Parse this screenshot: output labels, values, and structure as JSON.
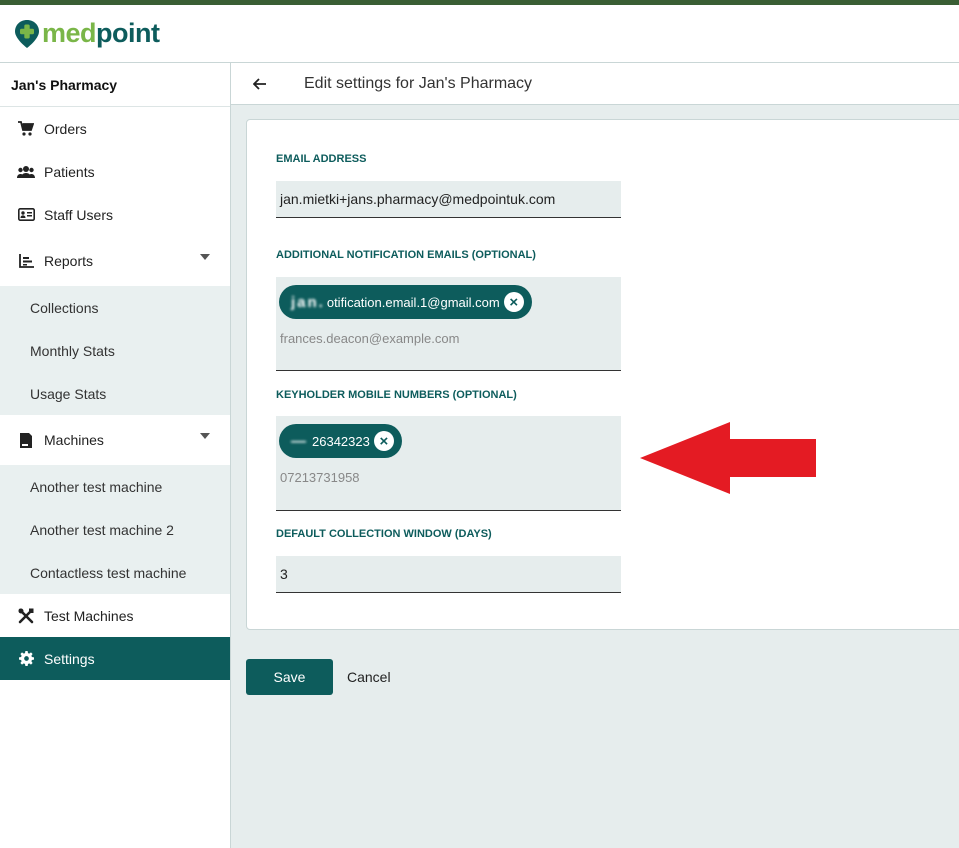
{
  "brand": {
    "name_part1": "med",
    "name_part2": "point"
  },
  "sidebar": {
    "pharmacy": "Jan's Pharmacy",
    "items": [
      {
        "label": "Orders",
        "icon": "cart-icon"
      },
      {
        "label": "Patients",
        "icon": "users-icon"
      },
      {
        "label": "Staff Users",
        "icon": "id-card-icon"
      },
      {
        "label": "Reports",
        "icon": "bar-chart-icon"
      },
      {
        "label": "Collections"
      },
      {
        "label": "Monthly Stats"
      },
      {
        "label": "Usage Stats"
      },
      {
        "label": "Machines",
        "icon": "machine-icon"
      },
      {
        "label": "Another test machine"
      },
      {
        "label": "Another test machine 2"
      },
      {
        "label": "Contactless test machine"
      },
      {
        "label": "Test Machines",
        "icon": "tools-icon"
      },
      {
        "label": "Settings",
        "icon": "gear-icon"
      }
    ]
  },
  "page": {
    "title": "Edit settings for Jan's Pharmacy"
  },
  "form": {
    "email_label": "EMAIL ADDRESS",
    "email_value": "jan.mietki+jans.pharmacy@medpointuk.com",
    "notify_label": "ADDITIONAL NOTIFICATION EMAILS (OPTIONAL)",
    "notify_chip_redacted": "jan.",
    "notify_chip_text": "otification.email.1@gmail.com",
    "notify_placeholder": "frances.deacon@example.com",
    "keyholder_label": "KEYHOLDER MOBILE NUMBERS (OPTIONAL)",
    "keyholder_chip_redacted": "—",
    "keyholder_chip_text": "26342323",
    "keyholder_placeholder": "07213731958",
    "window_label": "DEFAULT COLLECTION WINDOW (DAYS)",
    "window_value": "3"
  },
  "actions": {
    "save": "Save",
    "cancel": "Cancel"
  },
  "colors": {
    "primary": "#0d5c5c",
    "brand_green": "#7ab648",
    "arrow": "#e41b23"
  }
}
